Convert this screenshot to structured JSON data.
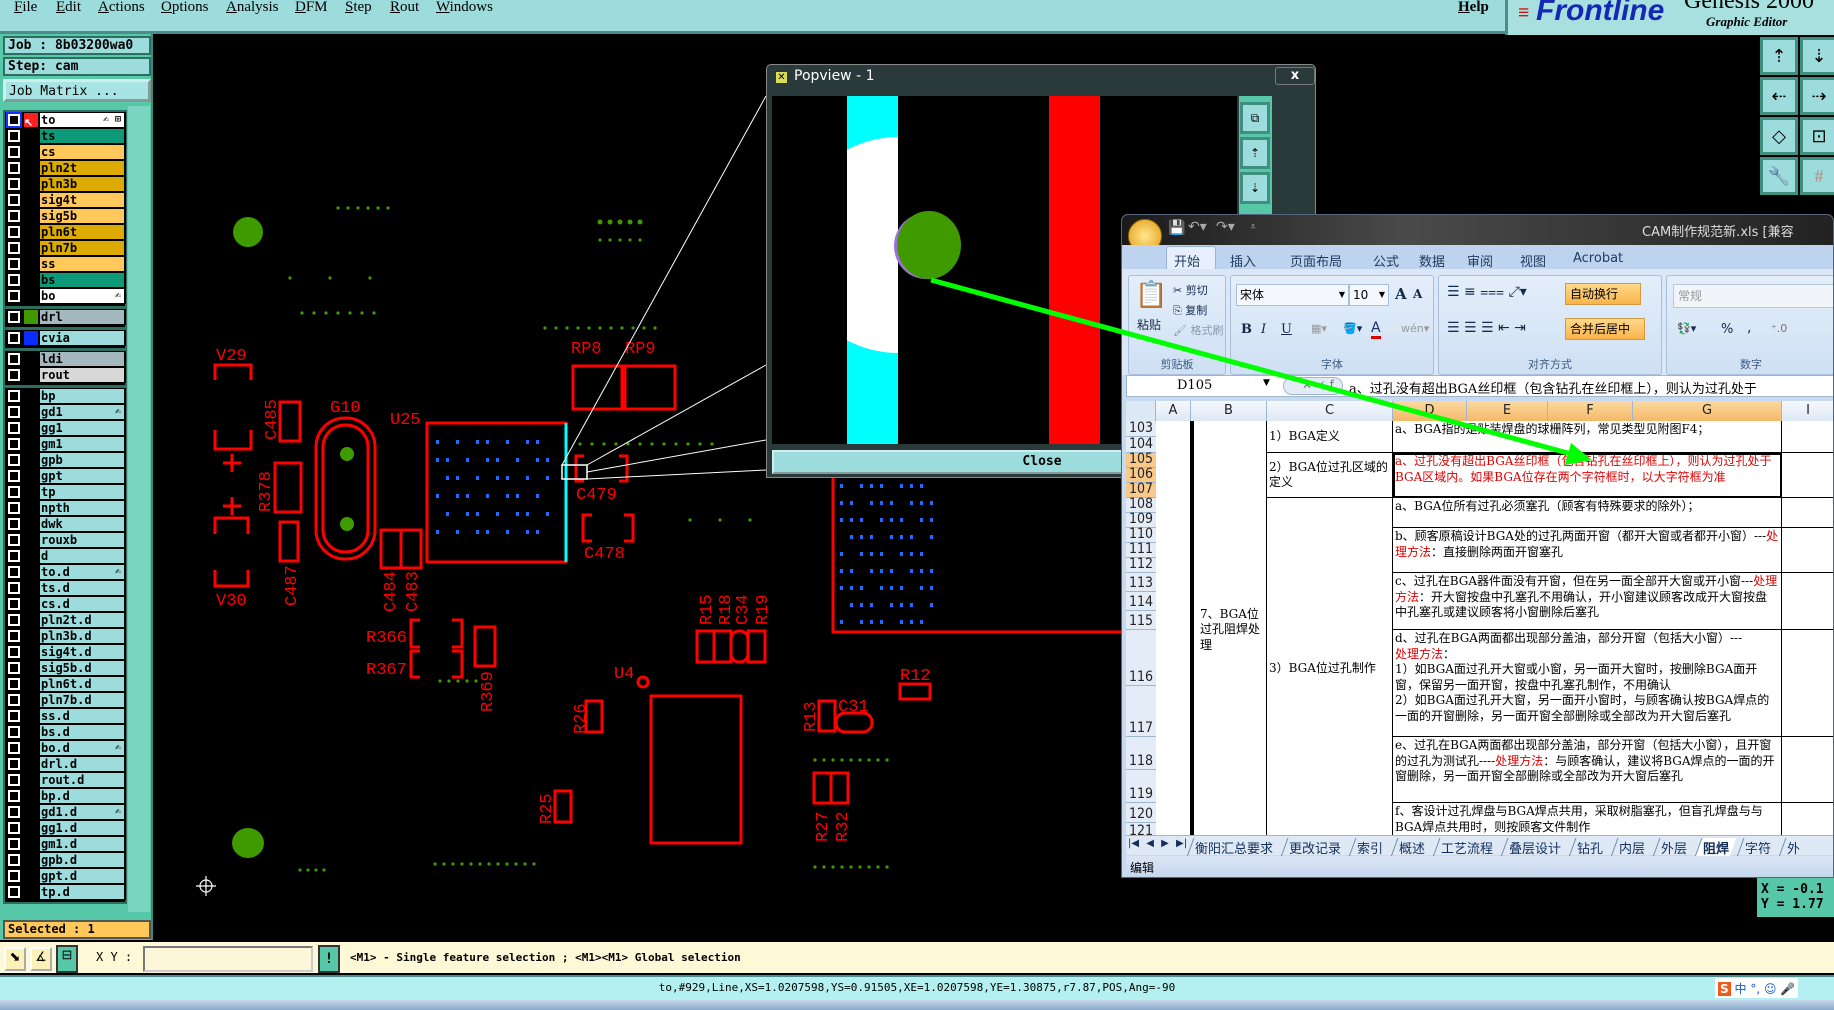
{
  "menu": {
    "items": [
      "File",
      "Edit",
      "Actions",
      "Options",
      "Analysis",
      "DFM",
      "Step",
      "Rout",
      "Windows"
    ],
    "help": "Help"
  },
  "logo": {
    "brand": "Frontline",
    "product": "Genesis 2000",
    "subtitle": "Graphic Editor"
  },
  "left_panel": {
    "job": "Job : 8b03200wa0",
    "step": "Step: cam",
    "job_matrix_button": "Job Matrix ...",
    "selected": "Selected : 1",
    "layer_groups": [
      [
        {
          "name": "to",
          "color": "#ffffff",
          "mark": "✍ ⊞",
          "swatch": "#ff2020",
          "active": true
        },
        {
          "name": "ts",
          "color": "#0e9a78"
        },
        {
          "name": "cs",
          "color": "#ffc85a"
        },
        {
          "name": "pln2t",
          "color": "#dcaa00"
        },
        {
          "name": "pln3b",
          "color": "#dcaa00"
        },
        {
          "name": "sig4t",
          "color": "#ffc85a"
        },
        {
          "name": "sig5b",
          "color": "#ffc85a"
        },
        {
          "name": "pln6t",
          "color": "#dcaa00"
        },
        {
          "name": "pln7b",
          "color": "#dcaa00"
        },
        {
          "name": "ss",
          "color": "#ffc85a"
        },
        {
          "name": "bs",
          "color": "#0e9a78"
        },
        {
          "name": "bo",
          "color": "#ffffff",
          "mark": "✍"
        }
      ],
      [
        {
          "name": "drl",
          "color": "#a4b8c0",
          "swatch": "#3f9a00"
        }
      ],
      [
        {
          "name": "cvia",
          "color": "#9ddcdc",
          "swatch": "#0a2dff"
        }
      ],
      [
        {
          "name": "ldi",
          "color": "#a4b8c0"
        },
        {
          "name": "rout",
          "color": "#d8d8d8"
        }
      ],
      [
        {
          "name": "bp",
          "color": "#9ddcdc"
        },
        {
          "name": "gd1",
          "color": "#9ddcdc",
          "mark": "✍"
        },
        {
          "name": "gg1",
          "color": "#9ddcdc"
        },
        {
          "name": "gm1",
          "color": "#9ddcdc"
        },
        {
          "name": "gpb",
          "color": "#9ddcdc"
        },
        {
          "name": "gpt",
          "color": "#9ddcdc"
        },
        {
          "name": "tp",
          "color": "#9ddcdc"
        },
        {
          "name": "npth",
          "color": "#9ddcdc"
        },
        {
          "name": "dwk",
          "color": "#9ddcdc"
        },
        {
          "name": "rouxb",
          "color": "#9ddcdc"
        },
        {
          "name": "d",
          "color": "#9ddcdc"
        },
        {
          "name": "to.d",
          "color": "#9ddcdc",
          "mark": "✍"
        },
        {
          "name": "ts.d",
          "color": "#9ddcdc"
        },
        {
          "name": "cs.d",
          "color": "#9ddcdc"
        },
        {
          "name": "pln2t.d",
          "color": "#9ddcdc"
        },
        {
          "name": "pln3b.d",
          "color": "#9ddcdc"
        },
        {
          "name": "sig4t.d",
          "color": "#9ddcdc"
        },
        {
          "name": "sig5b.d",
          "color": "#9ddcdc"
        },
        {
          "name": "pln6t.d",
          "color": "#9ddcdc"
        },
        {
          "name": "pln7b.d",
          "color": "#9ddcdc"
        },
        {
          "name": "ss.d",
          "color": "#9ddcdc"
        },
        {
          "name": "bs.d",
          "color": "#9ddcdc"
        },
        {
          "name": "bo.d",
          "color": "#9ddcdc",
          "mark": "✍"
        },
        {
          "name": "drl.d",
          "color": "#9ddcdc"
        },
        {
          "name": "rout.d",
          "color": "#9ddcdc"
        },
        {
          "name": "bp.d",
          "color": "#9ddcdc"
        },
        {
          "name": "gd1.d",
          "color": "#9ddcdc",
          "mark": "✍"
        },
        {
          "name": "gg1.d",
          "color": "#9ddcdc"
        },
        {
          "name": "gm1.d",
          "color": "#9ddcdc"
        },
        {
          "name": "gpb.d",
          "color": "#9ddcdc"
        },
        {
          "name": "gpt.d",
          "color": "#9ddcdc"
        },
        {
          "name": "tp.d",
          "color": "#9ddcdc"
        }
      ]
    ]
  },
  "pcb": {
    "labels": [
      "V29",
      "V30",
      "C485",
      "R378",
      "C487",
      "G10",
      "U25",
      "C484",
      "C483",
      "RP8",
      "RP9",
      "C479",
      "C478",
      "R366",
      "R367",
      "R369",
      "R15",
      "R18",
      "C34",
      "R19",
      "U4",
      "R26",
      "R13",
      "C31",
      "R12",
      "R25",
      "R27",
      "R32"
    ],
    "colors": {
      "feature": "#ff0000",
      "pad": "#3f9a00",
      "via": "#1e6bff",
      "highlight": "#00ffff"
    }
  },
  "popview": {
    "title": "Popview - 1",
    "close_x": "x",
    "close_button": "Close"
  },
  "coords": {
    "x": "X = -0.1",
    "y": "Y = 1.77"
  },
  "xybar": {
    "label": "X Y :",
    "input_value": "",
    "hint": "<M1> - Single feature selection ; <M1><M1> Global selection",
    "warn": "!"
  },
  "status": "to,#929,Line,XS=1.0207598,YS=0.91505,XE=1.0207598,YE=1.30875,r7.87,POS,Ang=-90",
  "ime": [
    "S",
    "中",
    "°,",
    "☺",
    "🎤"
  ],
  "excel": {
    "title": "CAM制作规范新.xls  [兼容",
    "ribbon_tabs": [
      "开始",
      "插入",
      "页面布局",
      "公式",
      "数据",
      "审阅",
      "视图",
      "Acrobat"
    ],
    "clipboard": {
      "paste": "粘贴",
      "cut": "剪切",
      "copy": "复制",
      "format_painter": "格式刷",
      "group": "剪贴板"
    },
    "font": {
      "name": "宋体",
      "size": "10",
      "bold": "B",
      "italic": "I",
      "underline": "U",
      "grow": "A",
      "shrink": "A",
      "group": "字体"
    },
    "align": {
      "wrap": "自动换行",
      "merge": "合并后居中",
      "group": "对齐方式"
    },
    "number": {
      "format": "常规",
      "percent": "%",
      "comma": ",",
      "group": "数字"
    },
    "name_box": "D105",
    "formula": "a、过孔没有超出BGA丝印框（包含钻孔在丝印框上），则认为过孔处于",
    "columns": [
      "A",
      "B",
      "C",
      "D",
      "E",
      "F",
      "G",
      "I"
    ],
    "rows": [
      103,
      104,
      105,
      106,
      107,
      108,
      109,
      110,
      111,
      112,
      113,
      114,
      115,
      116,
      117,
      118,
      119,
      120,
      121
    ],
    "b_cell": "7、BGA位过孔阻焊处理",
    "c_cells": [
      "1）BGA定义",
      "2）BGA位过孔区域的定义",
      "3）BGA位过孔制作"
    ],
    "d_cells": [
      [
        {
          "t": "a、BGA指的是贴装焊盘的球栅阵列，常见类型见附图F4；"
        }
      ],
      [
        {
          "t": "a、过孔没有超出BGA丝印框（包含钻孔在丝印框上），则认为过孔处于BGA区域内。如果BGA位存在两个字符框时，以大字符框为准",
          "red": true
        }
      ],
      [
        {
          "t": "a、BGA位所有过孔必须塞孔（顾客有特殊要求的除外）；"
        }
      ],
      [
        {
          "t": "b、顾客原稿设计BGA处的过孔两面开窗（都开大窗或者都开小窗）---"
        },
        {
          "t": "处理方法",
          "red": true
        },
        {
          "t": "：直接删除两面开窗塞孔"
        }
      ],
      [
        {
          "t": "c、过孔在BGA器件面没有开窗，但在另一面全部开大窗或开小窗---"
        },
        {
          "t": "处理方法",
          "red": true
        },
        {
          "t": "：开大窗按盘中孔塞孔不用确认，开小窗建议顾客改成开大窗按盘中孔塞孔或建议顾客将小窗删除后塞孔"
        }
      ],
      [
        {
          "t": "d、过孔在BGA两面都出现部分盖油，部分开窗（包括大小窗）---\n"
        },
        {
          "t": "处理方法",
          "red": true
        },
        {
          "t": "：\n1）如BGA面过孔开大窗或小窗，另一面开大窗时，按删除BGA面开窗，保留另一面开窗，按盘中孔塞孔制作，不用确认\n2）如BGA面过孔开大窗，另一面开小窗时，与顾客确认按BGA焊点的一面的开窗删除，另一面开窗全部删除或全部改为开大窗后塞孔"
        }
      ],
      [
        {
          "t": "e、过孔在BGA两面都出现部分盖油，部分开窗（包括大小窗），且开窗的过孔为测试孔----"
        },
        {
          "t": "处理方法",
          "red": true
        },
        {
          "t": "：与顾客确认，建议将BGA焊点的一面的开窗删除，另一面开窗全部删除或全部改为开大窗后塞孔"
        }
      ],
      [
        {
          "t": "f、客设计过孔焊盘与BGA焊点共用，采取树脂塞孔，但盲孔焊盘与与BGA焊点共用时，则按顾客文件制作"
        }
      ]
    ],
    "sheet_nav": [
      "|◀",
      "◀",
      "▶",
      "▶|"
    ],
    "sheets": [
      "衡阳汇总要求",
      "更改记录",
      "索引",
      "概述",
      "工艺流程",
      "叠层设计",
      "钻孔",
      "内层",
      "外层",
      "阻焊",
      "字符",
      "外"
    ],
    "active_sheet": "阻焊",
    "mode": "编辑"
  }
}
